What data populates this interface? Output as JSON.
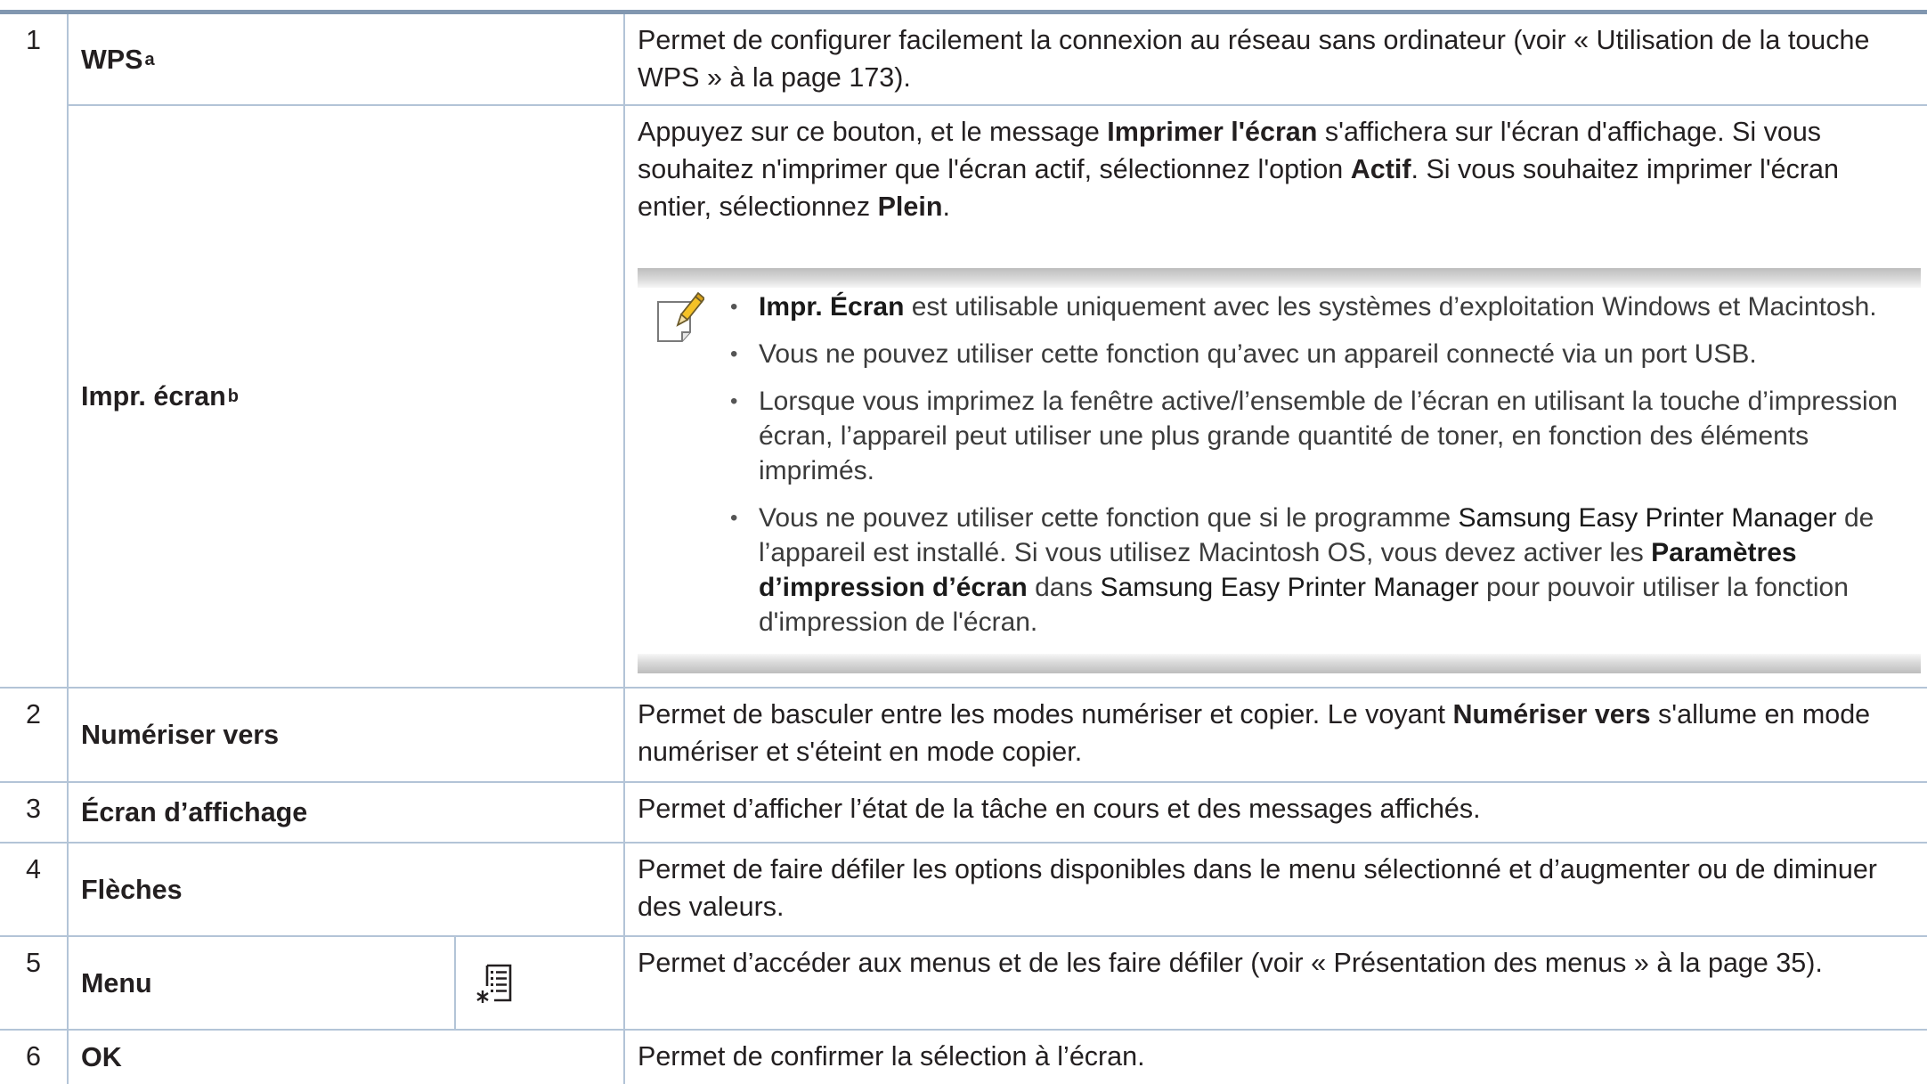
{
  "rows": [
    {
      "number": "1",
      "name": "WPS",
      "sup": "a",
      "description": [
        "Permet de configurer facilement la connexion au réseau sans ordinateur (voir « Utilisation de la touche WPS » à la page 173)."
      ]
    },
    {
      "name": "Impr. écran",
      "sup": "b",
      "description": [
        "Appuyez sur ce bouton, et le message ",
        "Imprimer l'écran",
        " s'affichera sur l'écran d'affichage. Si vous souhaitez n'imprimer que l'écran actif, sélectionnez l'option ",
        "Actif",
        ". Si vous souhaitez imprimer l'écran entier, sélectionnez ",
        "Plein",
        "."
      ],
      "note": [
        [
          "Impr. Écran",
          " est utilisable uniquement avec les systèmes d’exploitation Windows et Macintosh."
        ],
        [
          "Vous ne pouvez utiliser cette fonction qu’avec un appareil connecté via un port USB."
        ],
        [
          "Lorsque vous imprimez la fenêtre active/l’ensemble de l’écran en utilisant la touche d’impression écran, l’appareil peut utiliser une plus grande quantité de toner, en fonction des éléments imprimés."
        ],
        [
          "Vous ne pouvez utiliser cette fonction que si le programme ",
          "Samsung Easy Printer Manager",
          " de l’appareil est installé. Si vous utilisez Macintosh OS, vous devez activer les ",
          "Paramètres d’impression d’écran",
          " dans ",
          "Samsung Easy Printer Manager",
          " pour pouvoir utiliser la fonction d'impression de l'écran."
        ]
      ],
      "note_icon": "note-pencil-icon"
    },
    {
      "number": "2",
      "name": "Numériser vers",
      "description": [
        "Permet de basculer entre les modes numériser et copier. Le voyant ",
        "Numériser vers",
        " s'allume en mode numériser et s'éteint en mode copier."
      ]
    },
    {
      "number": "3",
      "name": "Écran d’affichage",
      "description": [
        "Permet d’afficher l’état de la tâche en cours et des messages affichés."
      ]
    },
    {
      "number": "4",
      "name": "Flèches",
      "description": [
        "Permet de faire défiler les options disponibles dans le menu sélectionné et d’augmenter ou de diminuer des valeurs."
      ]
    },
    {
      "number": "5",
      "name": "Menu",
      "icon": "menu-icon",
      "description": [
        "Permet d’accéder aux menus et de les faire défiler (voir « Présentation des menus » à la page 35)."
      ]
    },
    {
      "number": "6",
      "name": "OK",
      "description": [
        "Permet de confirmer la sélection à l’écran."
      ]
    }
  ],
  "colors": {
    "grid": "#b3c4d7",
    "top_rule": "#8197b0",
    "text": "#231f20",
    "note_text": "#3b3b3b",
    "pencil": "#f5c227"
  }
}
